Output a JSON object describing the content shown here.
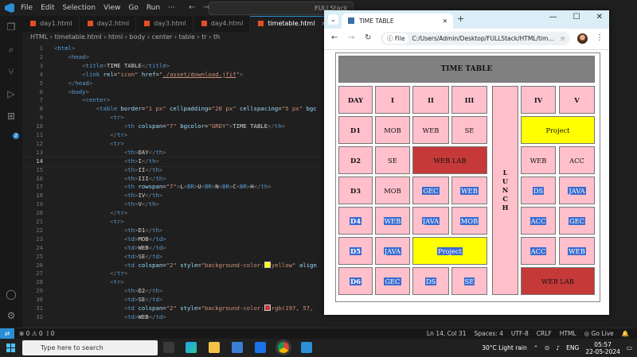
{
  "vscode": {
    "menu": [
      "File",
      "Edit",
      "Selection",
      "View",
      "Go",
      "Run",
      "···"
    ],
    "command_center": "FULLStack",
    "tabs": [
      {
        "label": "day1.html",
        "active": false
      },
      {
        "label": "day2.html",
        "active": false
      },
      {
        "label": "day3.html",
        "active": false
      },
      {
        "label": "day4.html",
        "active": false
      },
      {
        "label": "timetable.html",
        "active": true
      }
    ],
    "breadcrumb": [
      "HTML",
      "timetable.html",
      "html",
      "body",
      "center",
      "table",
      "tr",
      "th"
    ],
    "current_line": 14,
    "lines": [
      {
        "n": 1,
        "html": "<span class='p'>&lt;</span><span class='t'>html</span><span class='p'>&gt;</span>"
      },
      {
        "n": 2,
        "html": "    <span class='p'>&lt;</span><span class='t'>head</span><span class='p'>&gt;</span>"
      },
      {
        "n": 3,
        "html": "        <span class='p'>&lt;</span><span class='t'>title</span><span class='p'>&gt;</span>TIME TABLE<span class='p'>&lt;/</span><span class='t'>title</span><span class='p'>&gt;</span>"
      },
      {
        "n": 4,
        "html": "        <span class='p'>&lt;</span><span class='t'>link</span> <span class='a'>rel</span>=<span class='s'>\"icon\"</span> <span class='a'>href</span>=<span class='s'>\"<u>./asset/download.jfif</u>\"</span><span class='p'>&gt;</span>"
      },
      {
        "n": 5,
        "html": "    <span class='p'>&lt;/</span><span class='t'>head</span><span class='p'>&gt;</span>"
      },
      {
        "n": 6,
        "html": "    <span class='p'>&lt;</span><span class='t'>body</span><span class='p'>&gt;</span>"
      },
      {
        "n": 7,
        "html": "        <span class='p'>&lt;</span><span class='t'>center</span><span class='p'>&gt;</span>"
      },
      {
        "n": 8,
        "html": "            <span class='p'>&lt;</span><span class='t'>table</span> <span class='a'>border</span>=<span class='s'>\"1 px\"</span> <span class='a'>cellpadding</span>=<span class='s'>\"20 px\"</span> <span class='a'>cellspacing</span>=<span class='s'>\"5 px\"</span> <span class='a'>bgc</span>"
      },
      {
        "n": 9,
        "html": "                <span class='p'>&lt;</span><span class='t'>tr</span><span class='p'>&gt;</span>"
      },
      {
        "n": 10,
        "html": "                    <span class='p'>&lt;</span><span class='t'>th</span> <span class='a'>colspan</span>=<span class='s'>\"7\"</span> <span class='a'>bgcolor</span>=<span class='s'>\"GREY\"</span><span class='p'>&gt;</span>TIME TABLE<span class='p'>&lt;/</span><span class='t'>th</span><span class='p'>&gt;</span>"
      },
      {
        "n": 11,
        "html": "                <span class='p'>&lt;/</span><span class='t'>tr</span><span class='p'>&gt;</span>"
      },
      {
        "n": 12,
        "html": "                <span class='p'>&lt;</span><span class='t'>tr</span><span class='p'>&gt;</span>"
      },
      {
        "n": 13,
        "html": "                    <span class='p'>&lt;</span><span class='t'>th</span><span class='p'>&gt;</span>DAY<span class='p'>&lt;/</span><span class='t'>th</span><span class='p'>&gt;</span>"
      },
      {
        "n": 14,
        "html": "                    <span class='p'>&lt;</span><span class='t'>th</span><span class='p'>&gt;</span>I<span class='p'>&lt;/</span><span class='t'>th</span><span class='p'>&gt;</span>"
      },
      {
        "n": 15,
        "html": "                    <span class='p'>&lt;</span><span class='t'>th</span><span class='p'>&gt;</span>II<span class='p'>&lt;/</span><span class='t'>th</span><span class='p'>&gt;</span>"
      },
      {
        "n": 16,
        "html": "                    <span class='p'>&lt;</span><span class='t'>th</span><span class='p'>&gt;</span>III<span class='p'>&lt;/</span><span class='t'>th</span><span class='p'>&gt;</span>"
      },
      {
        "n": 17,
        "html": "                    <span class='p'>&lt;</span><span class='t'>th</span> <span class='a'>rowspan</span>=<span class='s'>\"7\"</span><span class='p'>&gt;</span>L<span class='p'>&lt;</span><span class='t'>BR</span><span class='p'>&gt;</span>U<span class='p'>&lt;</span><span class='t'>BR</span><span class='p'>&gt;</span>N<span class='p'>&lt;</span><span class='t'>BR</span><span class='p'>&gt;</span>C<span class='p'>&lt;</span><span class='t'>BR</span><span class='p'>&gt;</span>H<span class='p'>&lt;/</span><span class='t'>th</span><span class='p'>&gt;</span>"
      },
      {
        "n": 18,
        "html": "                    <span class='p'>&lt;</span><span class='t'>th</span><span class='p'>&gt;</span>IV<span class='p'>&lt;/</span><span class='t'>th</span><span class='p'>&gt;</span>"
      },
      {
        "n": 19,
        "html": "                    <span class='p'>&lt;</span><span class='t'>th</span><span class='p'>&gt;</span>V<span class='p'>&lt;/</span><span class='t'>th</span><span class='p'>&gt;</span>"
      },
      {
        "n": 20,
        "html": "                <span class='p'>&lt;/</span><span class='t'>tr</span><span class='p'>&gt;</span>"
      },
      {
        "n": 21,
        "html": "                <span class='p'>&lt;</span><span class='t'>tr</span><span class='p'>&gt;</span>"
      },
      {
        "n": 22,
        "html": "                    <span class='p'>&lt;</span><span class='t'>th</span><span class='p'>&gt;</span>D1<span class='p'>&lt;/</span><span class='t'>th</span><span class='p'>&gt;</span>"
      },
      {
        "n": 23,
        "html": "                    <span class='p'>&lt;</span><span class='t'>td</span><span class='p'>&gt;</span>MOB<span class='p'>&lt;/</span><span class='t'>td</span><span class='p'>&gt;</span>"
      },
      {
        "n": 24,
        "html": "                    <span class='p'>&lt;</span><span class='t'>td</span><span class='p'>&gt;</span>WEB<span class='p'>&lt;/</span><span class='t'>td</span><span class='p'>&gt;</span>"
      },
      {
        "n": 25,
        "html": "                    <span class='p'>&lt;</span><span class='t'>td</span><span class='p'>&gt;</span>SE<span class='p'>&lt;/</span><span class='t'>td</span><span class='p'>&gt;</span>"
      },
      {
        "n": 26,
        "html": "                    <span class='p'>&lt;</span><span class='t'>td</span> <span class='a'>colspan</span>=<span class='s'>\"2\"</span> <span class='a'>style</span>=<span class='s'>\"background-color:<i class='sw' style='background:#ffff00'></i>yellow\"</span> <span class='a'>align</span>"
      },
      {
        "n": 27,
        "html": "                <span class='p'>&lt;/</span><span class='t'>tr</span><span class='p'>&gt;</span>"
      },
      {
        "n": 28,
        "html": "                <span class='p'>&lt;</span><span class='t'>tr</span><span class='p'>&gt;</span>"
      },
      {
        "n": 29,
        "html": "                    <span class='p'>&lt;</span><span class='t'>th</span><span class='p'>&gt;</span>D2<span class='p'>&lt;/</span><span class='t'>th</span><span class='p'>&gt;</span>"
      },
      {
        "n": 30,
        "html": "                    <span class='p'>&lt;</span><span class='t'>td</span><span class='p'>&gt;</span>SE<span class='p'>&lt;/</span><span class='t'>td</span><span class='p'>&gt;</span>"
      },
      {
        "n": 31,
        "html": "                    <span class='p'>&lt;</span><span class='t'>td</span> <span class='a'>colspan</span>=<span class='s'>\"2\"</span> <span class='a'>style</span>=<span class='s'>\"background-color:<i class='sw' style='background:#c53939'></i>rgb(197, 57,</span>"
      },
      {
        "n": 32,
        "html": "                    <span class='p'>&lt;</span><span class='t'>td</span><span class='p'>&gt;</span>WEB<span class='p'>&lt;/</span><span class='t'>td</span><span class='p'>&gt;</span>"
      }
    ],
    "status": {
      "errors": "⊗ 0 ⚠ 0",
      "ports": "⟟ 0",
      "position": "Ln 14, Col 31",
      "spaces": "Spaces: 4",
      "encoding": "UTF-8",
      "eol": "CRLF",
      "language": "HTML",
      "golive": "◎ Go Live",
      "bell": "🔔"
    }
  },
  "browser": {
    "tab_title": "TIME TABLE",
    "address_chip": "ⓘ File",
    "address": "C:/Users/Admin/Desktop/FULLStack/HTML/tim...",
    "star": "☆",
    "window_controls": [
      "—",
      "☐",
      "✕"
    ],
    "newtab": "+",
    "nav": [
      "←",
      "→",
      "↻"
    ]
  },
  "timetable": {
    "title": "TIME TABLE",
    "headers": [
      "DAY",
      "I",
      "II",
      "III",
      "IV",
      "V"
    ],
    "lunch": [
      "L",
      "U",
      "N",
      "C",
      "H"
    ],
    "rows": [
      {
        "day": "D1",
        "c1": "MOB",
        "c2": "WEB",
        "c3": "SE",
        "c45": "Project"
      },
      {
        "day": "D2",
        "c1": "SE",
        "c23": "WEB LAB",
        "c4": "WEB",
        "c5": "ACC"
      },
      {
        "day": "D3",
        "c1": "MOB",
        "c2": "GEC",
        "c3": "WEB",
        "c4": "DS",
        "c5": "JAVA"
      },
      {
        "day": "D4",
        "c1": "WEB",
        "c2": "JAVA",
        "c3": "MOB",
        "c4": "ACC",
        "c5": "GEC"
      },
      {
        "day": "D5",
        "c1": "JAVA",
        "c23": "Project",
        "c4": "ACC",
        "c5": "WEB"
      },
      {
        "day": "D6",
        "c1": "GEC",
        "c2": "DS",
        "c3": "SE",
        "c45": "WEB LAB"
      }
    ],
    "colors": {
      "header": "#808080",
      "cell": "#ffc0cb",
      "project": "#ffff00",
      "lab": "#c53939",
      "selection": "#3a6bd0"
    }
  },
  "taskbar": {
    "search_placeholder": "Type here to search",
    "weather": "30°C  Light rain",
    "lang": "ENG",
    "time": "05:57",
    "date": "22-05-2024"
  }
}
